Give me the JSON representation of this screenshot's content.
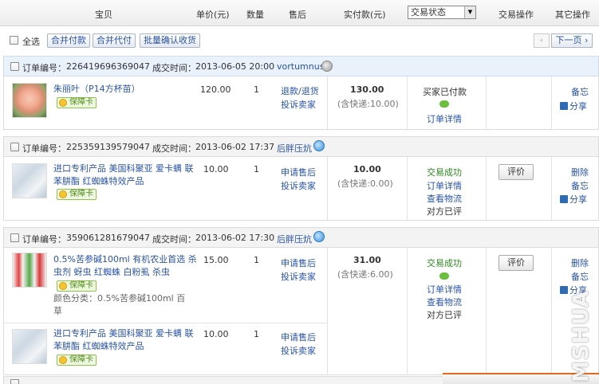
{
  "header": {
    "col_item": "宝贝",
    "col_price": "单价(元)",
    "col_qty": "数量",
    "col_after_sale": "售后",
    "col_paid": "实付款(元)",
    "status_filter": "交易状态",
    "col_actions": "交易操作",
    "col_other": "其它操作"
  },
  "toolbar": {
    "select_all": "全选",
    "merge_pay": "合并付款",
    "merge_proxy_pay": "合并代付",
    "batch_confirm": "批量确认收货",
    "prev": "‹",
    "next": "下一页 ›"
  },
  "orders": [
    {
      "order_label": "订单编号：",
      "order_no": "226419696369047",
      "time_label": "成交时间：",
      "time": "2013-06-05 20:00",
      "seller": "vortumnus",
      "items": [
        {
          "title": "朱丽叶（P14方杯苗）",
          "badge": "保障卡",
          "price": "120.00",
          "qty": "1",
          "after_sale": [
            "退款/退货",
            "投诉卖家"
          ]
        }
      ],
      "total": "130.00",
      "shipping": "(含快递:10.00)",
      "status": [
        "买家已付款",
        "订单详情"
      ],
      "actions": [],
      "other": [
        "备忘",
        "分享"
      ]
    },
    {
      "order_label": "订单编号：",
      "order_no": "225359139579047",
      "time_label": "成交时间：",
      "time": "2013-06-02 17:37",
      "seller": "后胖压炕",
      "items": [
        {
          "title": "进口专利产品 美国科聚亚 爱卡螨 联苯肼酯 红蜘蛛特效产品",
          "badge": "保障卡",
          "price": "10.00",
          "qty": "1",
          "after_sale": [
            "申请售后",
            "投诉卖家"
          ]
        }
      ],
      "total": "10.00",
      "shipping": "(含快递:0.00)",
      "status": [
        "交易成功",
        "订单详情",
        "查看物流",
        "对方已评"
      ],
      "actions": [
        "评价"
      ],
      "other": [
        "删除",
        "备忘",
        "分享"
      ]
    },
    {
      "order_label": "订单编号：",
      "order_no": "359061281679047",
      "time_label": "成交时间：",
      "time": "2013-06-02 17:30",
      "seller": "后胖压炕",
      "items": [
        {
          "title": "0.5%苦参碱100ml 有机农业首选 杀虫剂 蚜虫 红蜘蛛 白粉虱 杀虫",
          "badge": "保障卡",
          "spec": "颜色分类：0.5%苦参碱100ml 百草",
          "price": "15.00",
          "qty": "1",
          "after_sale": [
            "申请售后",
            "投诉卖家"
          ]
        },
        {
          "title": "进口专利产品 美国科聚亚 爱卡螨 联苯肼酯 红蜘蛛特效产品",
          "badge": "保障卡",
          "price": "10.00",
          "qty": "1",
          "after_sale": [
            "申请售后",
            "投诉卖家"
          ]
        }
      ],
      "total": "31.00",
      "shipping": "(含快递:6.00)",
      "status": [
        "交易成功",
        "订单详情",
        "查看物流",
        "对方已评"
      ],
      "actions": [
        "评价"
      ],
      "other": [
        "删除",
        "备忘",
        "分享"
      ]
    }
  ],
  "watermark": "MSHUA",
  "colors": {
    "link": "#2953a6",
    "success": "#2b8a1e",
    "badge_green": "#8cc44c"
  }
}
